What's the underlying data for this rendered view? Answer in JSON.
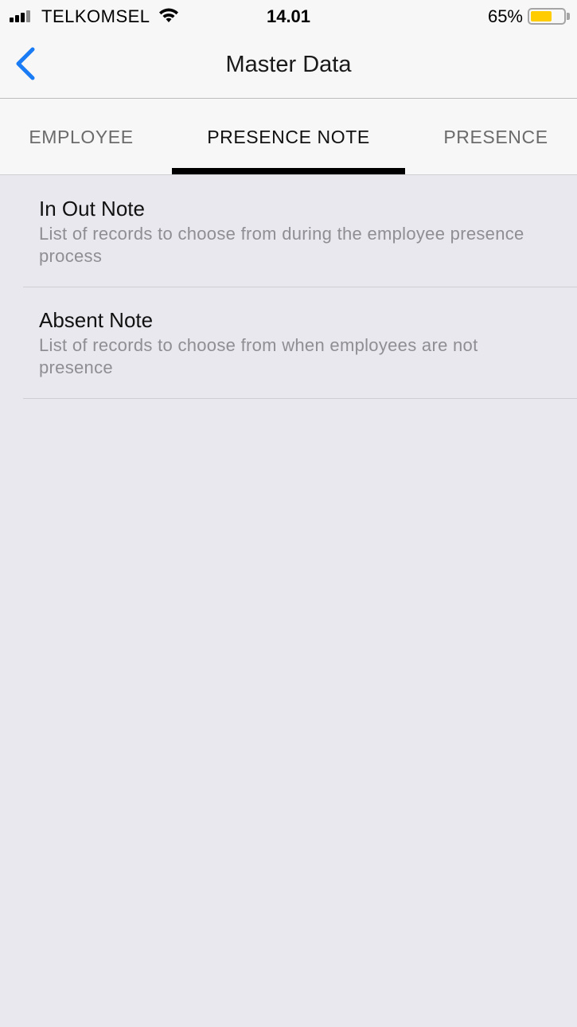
{
  "status_bar": {
    "carrier": "TELKOMSEL",
    "time": "14.01",
    "battery_percent": "65%",
    "battery_level": 0.65,
    "battery_color": "#FFCC00",
    "signal_icon": "signal-bars-icon",
    "wifi_icon": "wifi-icon"
  },
  "navbar": {
    "title": "Master Data",
    "back_icon": "chevron-left-icon",
    "accent_color": "#1A7CF5"
  },
  "tabs": {
    "items": [
      {
        "label": "EMPLOYEE"
      },
      {
        "label": "PRESENCE NOTE"
      },
      {
        "label": "PRESENCE"
      }
    ],
    "active_index": 1
  },
  "list": {
    "items": [
      {
        "title": "In Out Note",
        "description": "List of records to choose from during the employee presence process"
      },
      {
        "title": "Absent Note",
        "description": "List of records to choose from when employees are not presence"
      }
    ]
  }
}
